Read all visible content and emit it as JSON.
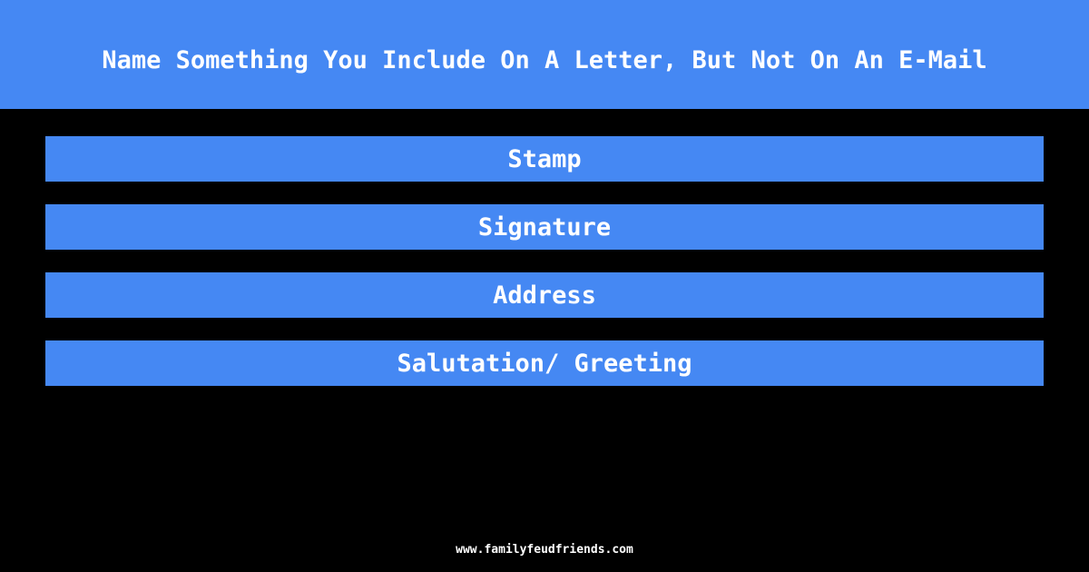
{
  "header": {
    "title": "Name Something You Include On A Letter, But Not On An E-Mail"
  },
  "answers": [
    {
      "label": "Stamp"
    },
    {
      "label": "Signature"
    },
    {
      "label": "Address"
    },
    {
      "label": "Salutation/ Greeting"
    }
  ],
  "footer": {
    "url": "www.familyfeudfriends.com"
  },
  "colors": {
    "accent": "#4588f3",
    "background": "#000000",
    "text": "#ffffff"
  }
}
